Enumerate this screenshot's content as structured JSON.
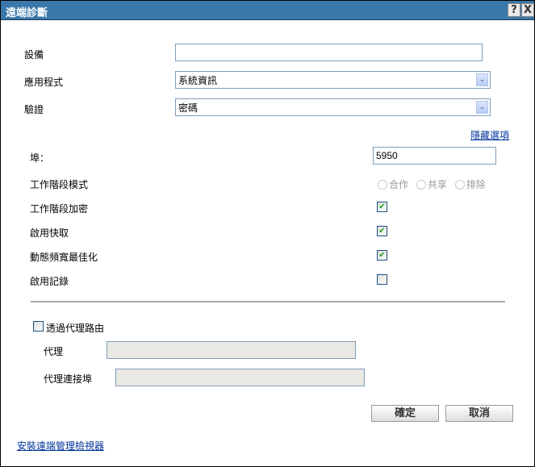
{
  "window": {
    "title": "遠端診斷",
    "help": "?",
    "close": "X"
  },
  "form": {
    "device_label": "設備",
    "device_value": "",
    "app_label": "應用程式",
    "app_value": "系統資訊",
    "auth_label": "驗證",
    "auth_value": "密碼",
    "hide_options": "隱藏選項",
    "port_label": "埠：",
    "port_value": "5950",
    "session_mode_label": "工作階段模式",
    "session_modes": [
      "合作",
      "共享",
      "排除"
    ],
    "session_encrypt_label": "工作階段加密",
    "session_encrypt_checked": true,
    "cache_label": "啟用快取",
    "cache_checked": true,
    "bandwidth_label": "動態頻寬最佳化",
    "bandwidth_checked": true,
    "logging_label": "啟用記錄",
    "logging_checked": false,
    "proxy_route_label": "透過代理路由",
    "proxy_route_checked": false,
    "proxy_label": "代理",
    "proxy_value": "",
    "proxy_port_label": "代理連接埠",
    "proxy_port_value": ""
  },
  "buttons": {
    "ok": "確定",
    "cancel": "取消"
  },
  "footer_link": "安裝遠端管理檢視器"
}
